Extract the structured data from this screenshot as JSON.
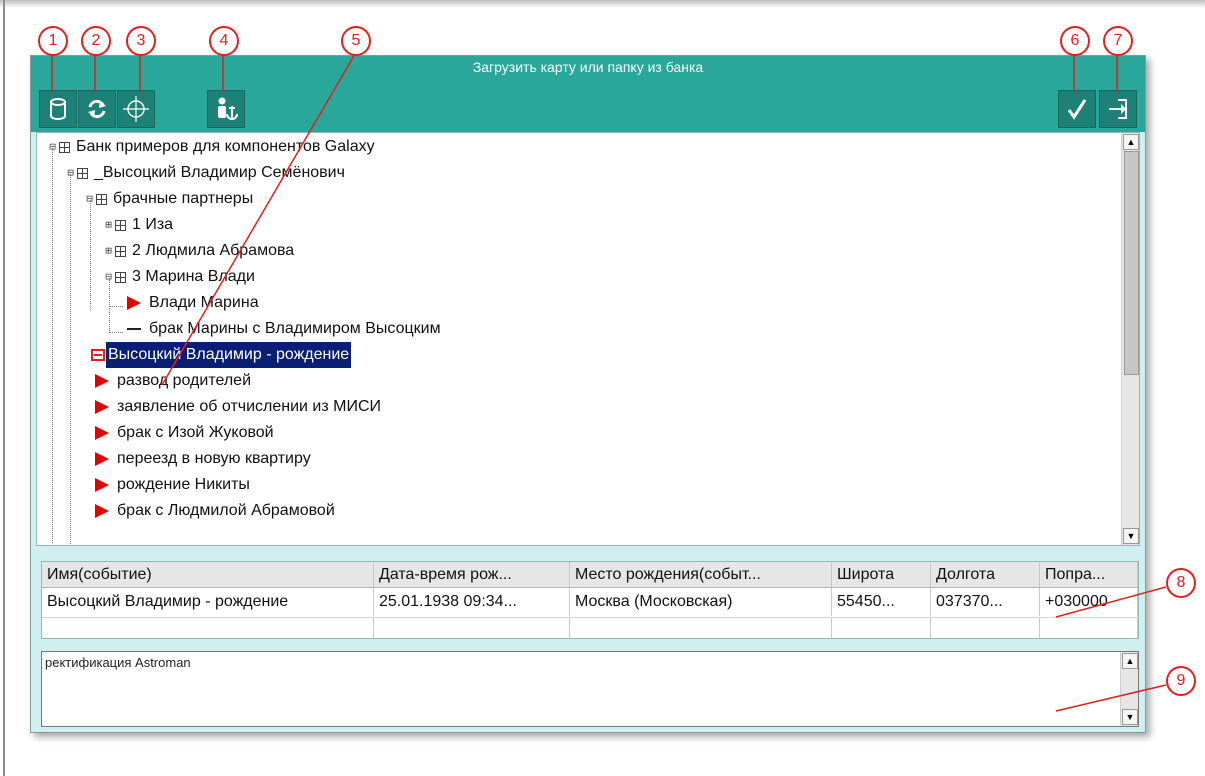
{
  "window": {
    "title": "Загрузить карту или папку из банка"
  },
  "toolbar": {
    "buttons": [
      {
        "name": "database-button",
        "icon": "database-icon"
      },
      {
        "name": "refresh-button",
        "icon": "refresh-icon"
      },
      {
        "name": "target-button",
        "icon": "crosshair-icon"
      },
      {
        "name": "person-anchor-button",
        "icon": "person-anchor-icon"
      },
      {
        "name": "confirm-button",
        "icon": "checkmark-icon"
      },
      {
        "name": "exit-button",
        "icon": "exit-icon"
      }
    ]
  },
  "tree": {
    "items": [
      {
        "label": "Банк примеров для компонентов Galaxy",
        "type": "folder"
      },
      {
        "label": "_Высоцкий Владимир Семёнович",
        "type": "folder"
      },
      {
        "label": "брачные партнеры",
        "type": "folder"
      },
      {
        "label": "1 Иза",
        "type": "folder",
        "expanded": false
      },
      {
        "label": "2 Людмила Абрамова",
        "type": "folder",
        "expanded": false
      },
      {
        "label": "3 Марина Влади",
        "type": "folder"
      },
      {
        "label": "Влади Марина",
        "type": "map"
      },
      {
        "label": "брак Марины с Владимиром Высоцким",
        "type": "event"
      },
      {
        "label": "Высоцкий Владимир - рождение",
        "type": "selected"
      },
      {
        "label": "развод родителей",
        "type": "map"
      },
      {
        "label": "заявление об отчислении из МИСИ",
        "type": "map"
      },
      {
        "label": "брак с Изой Жуковой",
        "type": "map"
      },
      {
        "label": "переезд в новую квартиру",
        "type": "map"
      },
      {
        "label": "рождение Никиты",
        "type": "map"
      },
      {
        "label": "брак с Людмилой Абрамовой",
        "type": "map"
      }
    ]
  },
  "grid": {
    "columns": [
      "Имя(событие)",
      "Дата-время рож...",
      "Место рождения(событ...",
      "Широта",
      "Долгота",
      "Попра..."
    ],
    "rows": [
      [
        "Высоцкий Владимир - рождение",
        "25.01.1938 09:34...",
        "Москва (Московская)",
        "55450...",
        "037370...",
        "+030000"
      ]
    ]
  },
  "memo": {
    "text": "ректификация Astroman"
  },
  "callouts": [
    "1",
    "2",
    "3",
    "4",
    "5",
    "6",
    "7",
    "8",
    "9"
  ],
  "colors": {
    "toolbar": "#2aa79b",
    "button": "#1e8177",
    "window_bg": "#cfeff0",
    "selection": "#0a1f73",
    "marker": "#e80000",
    "callout": "#e02020"
  }
}
